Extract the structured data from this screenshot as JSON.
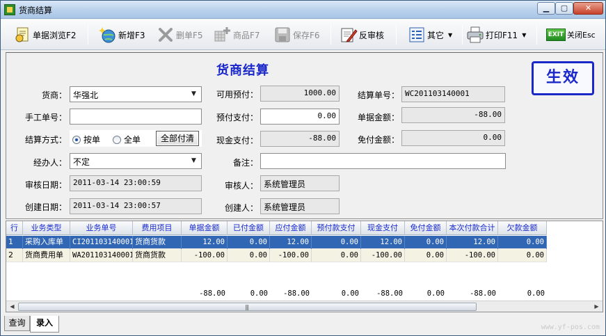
{
  "window": {
    "title": "货商结算"
  },
  "toolbar": {
    "browse": "单据浏览F2",
    "add": "新增F3",
    "delete": "删单F5",
    "product": "商品F7",
    "save": "保存F6",
    "unapprove": "反审核",
    "other": "其它",
    "print": "打印F11",
    "close": "关闭Esc",
    "exit_badge": "EXIT"
  },
  "form": {
    "title": "货商结算",
    "status": "生效",
    "vendor_label": "货商：",
    "vendor_value": "华强北",
    "manual_no_label": "手工单号：",
    "manual_no_value": "",
    "settle_mode_label": "结算方式：",
    "settle_mode_options": [
      "按单",
      "全单"
    ],
    "pay_all_button": "全部付清",
    "operator_label": "经办人：",
    "operator_value": "不定",
    "audit_date_label": "审核日期：",
    "audit_date_value": "2011-03-14 23:00:59",
    "create_date_label": "创建日期：",
    "create_date_value": "2011-03-14 23:00:57",
    "available_prepay_label": "可用预付：",
    "available_prepay_value": "1000.00",
    "prepay_pay_label": "预付支付：",
    "prepay_pay_value": "0.00",
    "cash_pay_label": "现金支付：",
    "cash_pay_value": "-88.00",
    "remark_label": "备注：",
    "remark_value": "",
    "auditor_label": "审核人：",
    "auditor_value": "系统管理员",
    "creator_label": "创建人：",
    "creator_value": "系统管理员",
    "settle_no_label": "结算单号：",
    "settle_no_value": "WC201103140001",
    "doc_amount_label": "单据金额：",
    "doc_amount_value": "-88.00",
    "free_amount_label": "免付金额：",
    "free_amount_value": "0.00"
  },
  "grid": {
    "headers": [
      "行",
      "业务类型",
      "业务单号",
      "费用项目",
      "单据金额",
      "已付金额",
      "应付金额",
      "预付款支付",
      "现金支付",
      "免付金额",
      "本次付款合计",
      "欠款金额"
    ],
    "rows": [
      [
        "1",
        "采购入库单",
        "CI201103140001",
        "货商货款",
        "12.00",
        "0.00",
        "12.00",
        "0.00",
        "12.00",
        "0.00",
        "12.00",
        "0.00"
      ],
      [
        "2",
        "货商费用单",
        "WA201103140001",
        "货商货款",
        "-100.00",
        "0.00",
        "-100.00",
        "0.00",
        "-100.00",
        "0.00",
        "-100.00",
        "0.00"
      ]
    ],
    "footer": [
      "",
      "",
      "",
      "",
      "-88.00",
      "0.00",
      "-88.00",
      "0.00",
      "-88.00",
      "0.00",
      "-88.00",
      "0.00"
    ],
    "scroll_grip": "|||"
  },
  "tabs": [
    "查询",
    "录入"
  ],
  "watermark": "www.yf-pos.com"
}
